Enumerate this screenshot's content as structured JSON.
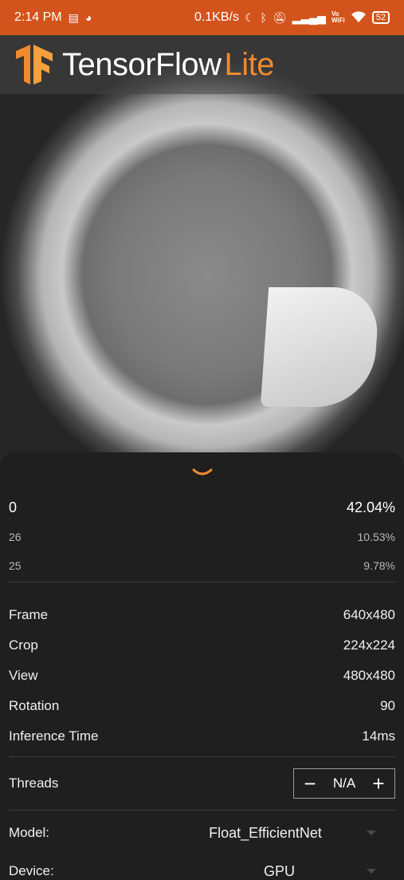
{
  "status_bar": {
    "time": "2:14 PM",
    "net_speed": "0.1KB/s",
    "vo_label": "Vo",
    "wifi_label": "WiFi",
    "battery": "52"
  },
  "app": {
    "title_main": "TensorFlow",
    "title_accent": "Lite",
    "accent_color": "#f08a2c",
    "status_color": "#d2541c"
  },
  "results": [
    {
      "label": "0",
      "score": "42.04%"
    },
    {
      "label": "26",
      "score": "10.53%"
    },
    {
      "label": "25",
      "score": "9.78%"
    }
  ],
  "info": {
    "frame_label": "Frame",
    "frame_value": "640x480",
    "crop_label": "Crop",
    "crop_value": "224x224",
    "view_label": "View",
    "view_value": "480x480",
    "rotation_label": "Rotation",
    "rotation_value": "90",
    "inference_label": "Inference Time",
    "inference_value": "14ms"
  },
  "threads": {
    "label": "Threads",
    "minus": "−",
    "value": "N/A",
    "plus": "+"
  },
  "model": {
    "label": "Model:",
    "value": "Float_EfficientNet"
  },
  "device": {
    "label": "Device:",
    "value": "GPU"
  }
}
